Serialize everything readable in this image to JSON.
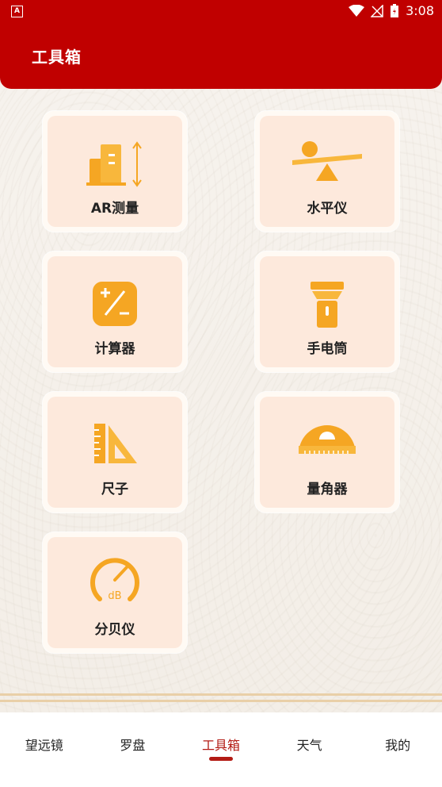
{
  "status_bar": {
    "time": "3:08"
  },
  "header": {
    "title": "工具箱"
  },
  "tools": [
    {
      "label": "AR测量",
      "icon": "ar-measure-icon"
    },
    {
      "label": "水平仪",
      "icon": "level-icon"
    },
    {
      "label": "计算器",
      "icon": "calculator-icon"
    },
    {
      "label": "手电筒",
      "icon": "flashlight-icon"
    },
    {
      "label": "尺子",
      "icon": "ruler-icon"
    },
    {
      "label": "量角器",
      "icon": "protractor-icon"
    },
    {
      "label": "分贝仪",
      "icon": "decibel-meter-icon",
      "icon_text": "dB"
    }
  ],
  "tabs": [
    {
      "label": "望远镜",
      "active": false
    },
    {
      "label": "罗盘",
      "active": false
    },
    {
      "label": "工具箱",
      "active": true
    },
    {
      "label": "天气",
      "active": false
    },
    {
      "label": "我的",
      "active": false
    }
  ],
  "colors": {
    "header": "#c00000",
    "accent": "#f5a623",
    "active_tab": "#b31b14"
  }
}
